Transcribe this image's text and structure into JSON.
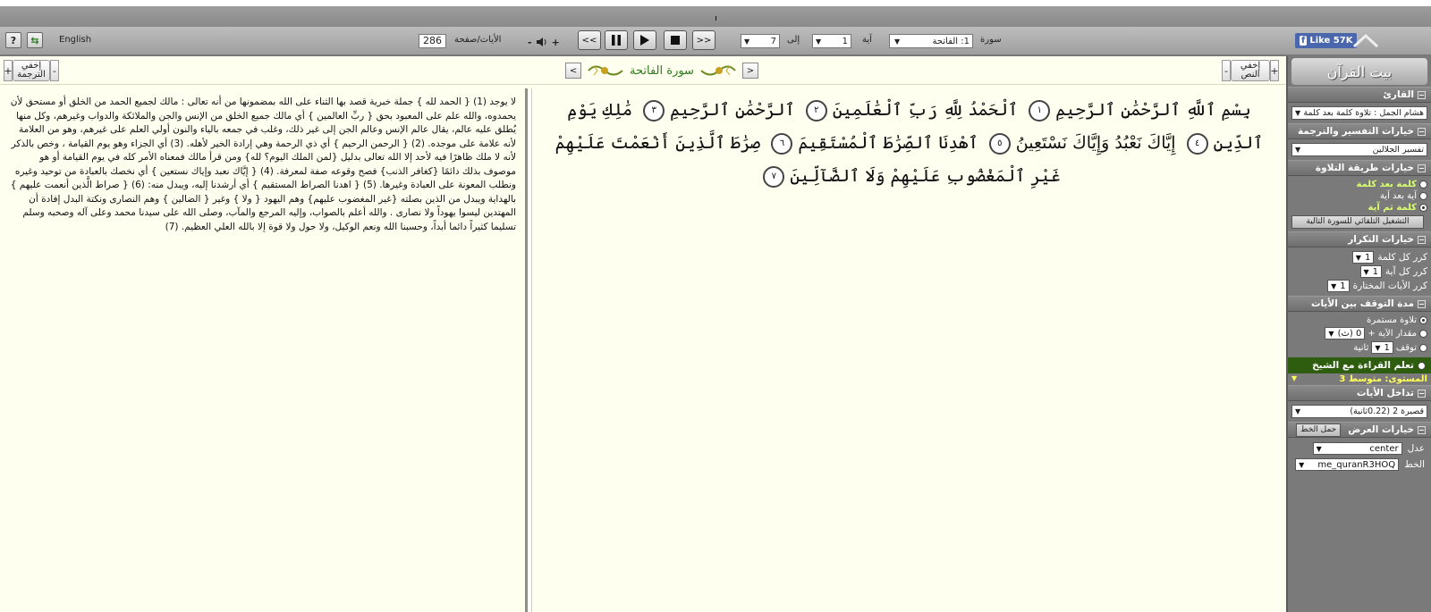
{
  "toolbar": {
    "help_label": "?",
    "refresh_label": "⇆",
    "language_label": "English",
    "ayat_per_page_value": "286",
    "ayat_per_page_label": "الأيات/صفحة",
    "volume_minus": "-",
    "volume_plus": "+",
    "prev_label": "<<",
    "next_label": ">>",
    "to_aya_value": "7",
    "to_label": "إلى",
    "from_aya_value": "1",
    "aya_label": "آية",
    "surah_value": "1: الفاتحة",
    "surah_label": "سورة",
    "fb_like_label": "Like 57K"
  },
  "headers": {
    "hide_text_label": "إخفي النص",
    "hide_translation_label": "إخفي الترجمة",
    "plus": "+",
    "minus": "-",
    "surah_title": "سورة الفاتحة",
    "left_arrow": "<",
    "right_arrow": ">"
  },
  "tafsir_text": "لا يوجد (1) { الحمد لله } جملة خبرية قصد بها الثناء على الله بمضمونها من أنه تعالى : مالك لجميع الحمد من الخلق أو مستحق لأن يحمدوه، والله علم على المعبود بحق { ربِّ العالمين } أي مالك جميع الخلق من الإنس والجن والملائكة والدواب وغيرهم، وكل منها يُطلق عليه عالم، يقال عالم الإنس وعالم الجن إلى غير ذلك، وغلب في جمعه بالياء والنون أولي العلم على غيرهم، وهو من العلامة لأنه علامة على موجده. (2) { الرحمن الرحيم } أي ذي الرحمة وهي إرادة الخير لأهله. (3) أي الجزاء وهو يوم القيامة ، وخص بالذكر لأنه لا ملك ظاهرًا فيه لأحد إلا الله تعالى بدليل {لمن الملك اليوم؟ لله} ومن قرأ مالك فمعناه الأمر كله في يوم القيامة أو هو موصوف بذلك دائمًا {كغافر الذنب} فصح وقوعه صفة لمعرفة. (4) { إيَّاك نعبد وإياك نستعين } أي نخصك بالعبادة من توحيد وغيره ونطلب المعونة على العبادة وغيرها. (5) { اهدنا الصراط المستقيم } أي أرشدنا إليه، ويبدل منه: (6) { صراط الَّذين أنعمت عليهم } بالهداية ويبدل من الذين بصلته {غير المغضوب عليهم} وهم اليهود { ولا } وغير { الضالين } وهم النصارى ونكتة البدل إفادة أن المهتدين ليسوا يهوداً ولا نصارى . والله أعلم بالصواب، وإليه المرجع والمآب، وصلى الله على سيدنا محمد وعلى آله وصحبه وسلم تسليما كثيراً دائما أبداً، وحسبنا الله ونعم الوكيل، ولا حول ولا قوة إلا بالله العلي العظيم. (7)",
  "quran": {
    "ayat": [
      {
        "text": "بِسْمِ ٱللَّهِ ٱلرَّحْمَٰنِ ٱلرَّحِيمِ",
        "num": "١"
      },
      {
        "text": "ٱلْحَمْدُ لِلَّهِ رَبِّ ٱلْعَٰلَمِينَ",
        "num": "٢"
      },
      {
        "text": "ٱلرَّحْمَٰنِ ٱلرَّحِيمِ",
        "num": "٣"
      },
      {
        "text": "مَٰلِكِ يَوْمِ ٱلدِّينِ",
        "num": "٤"
      },
      {
        "text": "إِيَّاكَ نَعْبُدُ وَإِيَّاكَ نَسْتَعِينُ",
        "num": "٥"
      },
      {
        "text": "ٱهْدِنَا ٱلصِّرَٰطَ ٱلْمُسْتَقِيمَ",
        "num": "٦"
      },
      {
        "text": "صِرَٰطَ ٱلَّذِينَ أَنْعَمْتَ عَلَيْهِمْ غَيْرِ ٱلْمَغْضُوبِ عَلَيْهِمْ وَلَا ٱلضَّآلِّينَ",
        "num": "٧"
      }
    ]
  },
  "panel": {
    "logo_text": "بيت القرآن",
    "reader_header": "القارئ",
    "reader_value": "هشام الجمل : تلاوة كلمة بعد كلمة",
    "tafsir_header": "خيارات التفسير والترجمة",
    "tafsir_value": "تفسير الجلالين",
    "method_header": "خيارات طريقة التلاوة",
    "method_opt1": "كلمة بعد كلمة",
    "method_opt2": "آية بعد آية",
    "method_opt3": "كلمة ثم آية",
    "auto_next_label": "التشغيل التلقائي للسورة التالية",
    "repeat_header": "خيارات التكرار",
    "repeat_word_label": "كرر كل كلمة",
    "repeat_word_value": "1",
    "repeat_aya_label": "كرر كل آية",
    "repeat_aya_value": "1",
    "repeat_selected_label": "كرر الأيات المختارة",
    "repeat_selected_value": "1",
    "pause_header": "مدة التوقف بين الأيات",
    "pause_opt1": "تلاوة مستمرة",
    "pause_opt2": "مقدار الآية +",
    "pause_opt2_value": "0 (ث)",
    "pause_opt3_prefix": "توقف",
    "pause_opt3_value": "1",
    "pause_opt3_suffix": "ثانية",
    "learn_header": "تعلم القراءة مع الشيخ",
    "level_label": "المستوى: متوسط 3",
    "overlap_header": "تداخل الأيات",
    "overlap_value": "قصيرة 2 (0.22ثانية)",
    "display_header": "خيارات العرض",
    "download_font_label": "حمل الخط",
    "align_label": "عدل",
    "align_value": "center",
    "font_label": "الخط",
    "font_value": "me_quranR3HOQ"
  }
}
